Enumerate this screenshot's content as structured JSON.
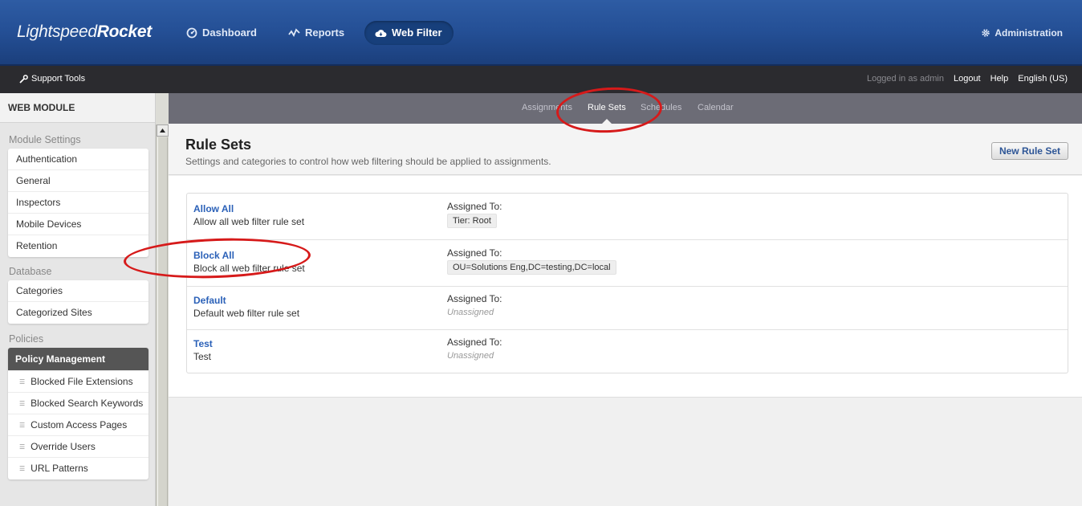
{
  "header": {
    "logo_light": "Lightspeed",
    "logo_bold": "Rocket",
    "nav": [
      {
        "label": "Dashboard",
        "icon": "dashboard-icon"
      },
      {
        "label": "Reports",
        "icon": "reports-icon"
      },
      {
        "label": "Web Filter",
        "icon": "cloud-icon"
      }
    ],
    "admin_label": "Administration",
    "colors": {
      "primary": "#244f95",
      "dark": "#2b2b2f",
      "link": "#2b61b8",
      "annotation": "#d61a1a"
    }
  },
  "subbar": {
    "support_label": "Support Tools",
    "logged_in": "Logged in as admin",
    "logout": "Logout",
    "help": "Help",
    "language": "English (US)"
  },
  "sidebar": {
    "title": "WEB MODULE",
    "module_settings": {
      "label": "Module Settings",
      "items": [
        "Authentication",
        "General",
        "Inspectors",
        "Mobile Devices",
        "Retention"
      ]
    },
    "database": {
      "label": "Database",
      "items": [
        "Categories",
        "Categorized Sites"
      ]
    },
    "policies": {
      "label": "Policies",
      "active": "Policy Management",
      "items": [
        "Blocked File Extensions",
        "Blocked Search Keywords",
        "Custom Access Pages",
        "Override Users",
        "URL Patterns"
      ]
    }
  },
  "tabs": [
    "Assignments",
    "Rule Sets",
    "Schedules",
    "Calendar"
  ],
  "page": {
    "title": "Rule Sets",
    "subtitle": "Settings and categories to control how web filtering should be applied to assignments.",
    "new_button": "New Rule Set",
    "assigned_label": "Assigned To:",
    "rules": [
      {
        "name": "Allow All",
        "description": "Allow all web filter rule set",
        "assigned": "Tier: Root"
      },
      {
        "name": "Block All",
        "description": "Block all web filter rule set",
        "assigned": "OU=Solutions Eng,DC=testing,DC=local"
      },
      {
        "name": "Default",
        "description": "Default web filter rule set",
        "assigned": "Unassigned"
      },
      {
        "name": "Test",
        "description": "Test",
        "assigned": "Unassigned"
      }
    ]
  }
}
